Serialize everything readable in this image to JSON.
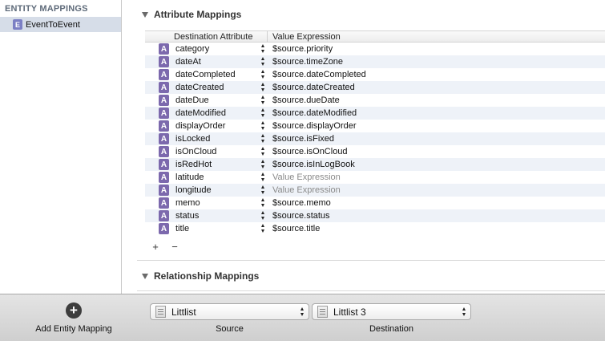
{
  "sidebar": {
    "header": "ENTITY MAPPINGS",
    "items": [
      {
        "badge": "E",
        "label": "EventToEvent"
      }
    ]
  },
  "attribute_mappings": {
    "title": "Attribute Mappings",
    "columns": {
      "destination": "Destination Attribute",
      "value": "Value Expression"
    },
    "rows": [
      {
        "badge": "A",
        "attribute": "category",
        "expression": "$source.priority"
      },
      {
        "badge": "A",
        "attribute": "dateAt",
        "expression": "$source.timeZone"
      },
      {
        "badge": "A",
        "attribute": "dateCompleted",
        "expression": "$source.dateCompleted"
      },
      {
        "badge": "A",
        "attribute": "dateCreated",
        "expression": "$source.dateCreated"
      },
      {
        "badge": "A",
        "attribute": "dateDue",
        "expression": "$source.dueDate"
      },
      {
        "badge": "A",
        "attribute": "dateModified",
        "expression": "$source.dateModified"
      },
      {
        "badge": "A",
        "attribute": "displayOrder",
        "expression": "$source.displayOrder"
      },
      {
        "badge": "A",
        "attribute": "isLocked",
        "expression": "$source.isFixed"
      },
      {
        "badge": "A",
        "attribute": "isOnCloud",
        "expression": "$source.isOnCloud"
      },
      {
        "badge": "A",
        "attribute": "isRedHot",
        "expression": "$source.isInLogBook"
      },
      {
        "badge": "A",
        "attribute": "latitude",
        "expression": "",
        "placeholder": "Value Expression"
      },
      {
        "badge": "A",
        "attribute": "longitude",
        "expression": "",
        "placeholder": "Value Expression"
      },
      {
        "badge": "A",
        "attribute": "memo",
        "expression": "$source.memo"
      },
      {
        "badge": "A",
        "attribute": "status",
        "expression": "$source.status"
      },
      {
        "badge": "A",
        "attribute": "title",
        "expression": "$source.title"
      }
    ],
    "add_button": "+",
    "remove_button": "−"
  },
  "relationship_mappings": {
    "title": "Relationship Mappings"
  },
  "toolbar": {
    "add_icon": "+",
    "add_label": "Add Entity Mapping",
    "source": {
      "value": "Littlist",
      "caption": "Source"
    },
    "destination": {
      "value": "Littlist 3",
      "caption": "Destination"
    }
  },
  "colors": {
    "entity_badge": "#7b7fc4",
    "attribute_badge": "#7c69ad",
    "selection": "#d6dde8",
    "row_stripe": "#eef2f8"
  },
  "icons": {
    "entity": "entity-badge-icon",
    "attribute": "attribute-badge-icon",
    "disclosure": "disclosure-triangle-icon",
    "stepper": "stepper-arrows-icon",
    "model": "model-file-icon"
  }
}
